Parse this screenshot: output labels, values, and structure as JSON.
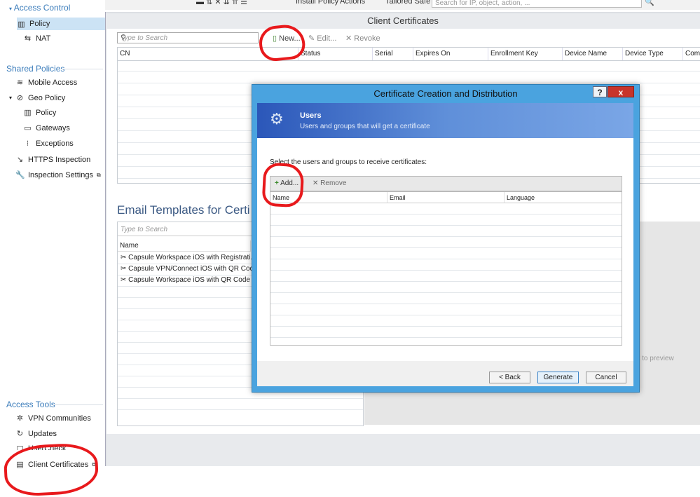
{
  "top_toolbar": {
    "install_policy": "Install Policy",
    "actions": "Actions",
    "tailored_safe": "Tailored Safe",
    "search_placeholder": "Search for IP, object, action, ..."
  },
  "sidebar": {
    "access_control": {
      "header": "Access Control",
      "items": [
        {
          "label": "Policy",
          "icon": "policy-icon",
          "selected": true
        },
        {
          "label": "NAT",
          "icon": "nat-icon"
        }
      ]
    },
    "shared_policies": {
      "header": "Shared Policies",
      "items": [
        {
          "label": "Mobile Access",
          "icon": "wifi-icon"
        },
        {
          "label": "Geo Policy",
          "icon": "geo-icon"
        },
        {
          "label": "Policy",
          "icon": "policy-icon"
        },
        {
          "label": "Gateways",
          "icon": "gateway-icon"
        },
        {
          "label": "Exceptions",
          "icon": "exceptions-icon"
        },
        {
          "label": "HTTPS Inspection",
          "icon": "https-icon"
        },
        {
          "label": "Inspection Settings",
          "icon": "wrench-icon"
        }
      ]
    },
    "access_tools": {
      "header": "Access Tools",
      "items": [
        {
          "label": "VPN Communities",
          "icon": "vpn-icon"
        },
        {
          "label": "Updates",
          "icon": "updates-icon"
        },
        {
          "label": "UserCheck",
          "icon": "usercheck-icon"
        },
        {
          "label": "Client Certificates",
          "icon": "certificate-icon"
        }
      ]
    }
  },
  "main": {
    "title": "Client Certificates",
    "search_placeholder": "Type to Search",
    "toolbar": {
      "new": "New...",
      "edit": "Edit...",
      "revoke": "Revoke"
    },
    "columns": [
      "CN",
      "Status",
      "Serial",
      "Expires On",
      "Enrollment Key",
      "Device Name",
      "Device Type",
      "Comm"
    ],
    "email_section_title": "Email Templates for Certi",
    "email_search_placeholder": "Type to Search",
    "email_column": "Name",
    "email_templates": [
      "Capsule Workspace iOS with Registrati...",
      "Capsule VPN/Connect iOS with QR Code",
      "Capsule Workspace iOS with QR Code"
    ],
    "preview_text": "ect to preview"
  },
  "modal": {
    "title": "Certificate Creation and Distribution",
    "help": "?",
    "close": "x",
    "banner_title": "Users",
    "banner_subtitle": "Users and groups that will get a certificate",
    "prompt": "Select the users and groups to receive certificates:",
    "add": "Add...",
    "remove": "Remove",
    "columns": [
      "Name",
      "Email",
      "Language"
    ],
    "back": "< Back",
    "generate": "Generate",
    "cancel": "Cancel"
  },
  "annotation_color": "#e8191c"
}
